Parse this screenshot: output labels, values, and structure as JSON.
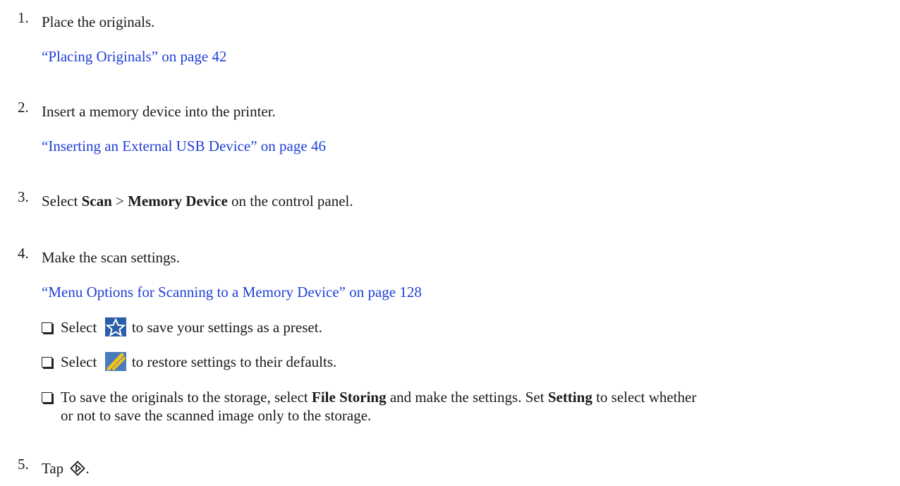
{
  "steps": [
    {
      "number": "1.",
      "text": "Place the originals.",
      "link": "“Placing Originals” on page 42"
    },
    {
      "number": "2.",
      "text": "Insert a memory device into the printer.",
      "link": "“Inserting an External USB Device” on page 46"
    },
    {
      "number": "3.",
      "text_pre": "Select ",
      "bold1": "Scan",
      "sep": " > ",
      "bold2": "Memory Device",
      "text_post": " on the control panel."
    },
    {
      "number": "4.",
      "text": "Make the scan settings.",
      "link": "“Menu Options for Scanning to a Memory Device” on page 128",
      "bullets": [
        {
          "pre": "Select ",
          "icon": "star-icon",
          "post": " to save your settings as a preset."
        },
        {
          "pre": "Select ",
          "icon": "wand-icon",
          "post": " to restore settings to their defaults."
        },
        {
          "line1_pre": "To save the originals to the storage, select ",
          "line1_bold": "File Storing",
          "line1_mid": " and make the settings. Set ",
          "line1_bold2": "Setting",
          "line1_post": " to select whether",
          "line2": "or not to save the scanned image only to the storage."
        }
      ]
    },
    {
      "number": "5.",
      "text_pre": "Tap ",
      "icon": "start-icon",
      "text_post": "."
    }
  ],
  "colors": {
    "link": "#1f3fd6",
    "text": "#1a1a1a",
    "star_icon_bg": "#2b5fa8",
    "wand_icon_bg": "#4a7bbf"
  }
}
